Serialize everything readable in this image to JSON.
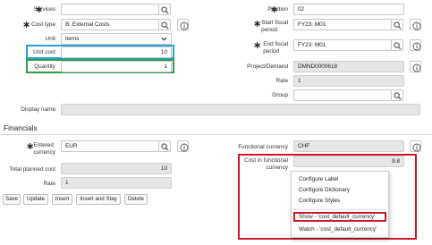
{
  "left": {
    "services": {
      "label": "Services",
      "value": ""
    },
    "cost_type": {
      "label": "Cost type",
      "value": "B: External Costs"
    },
    "unit": {
      "label": "Unit",
      "value": "items"
    },
    "unit_cost": {
      "label": "Unit cost",
      "value": "10"
    },
    "quantity": {
      "label": "Quantity",
      "value": "1"
    },
    "display_name": {
      "label": "Display name",
      "value": ""
    }
  },
  "right": {
    "position": {
      "label": "Position",
      "value": "02"
    },
    "start_fiscal_period": {
      "label_line1": "Start fiscal",
      "label_line2": "period",
      "value": "FY23: M01"
    },
    "end_fiscal_period": {
      "label_line1": "End fiscal",
      "label_line2": "period",
      "value": "FY23: M01"
    },
    "project_demand": {
      "label": "Project/Demand",
      "value": "DMND0000618"
    },
    "rate": {
      "label": "Rate",
      "value": "1"
    },
    "group": {
      "label": "Group",
      "value": ""
    }
  },
  "financials": {
    "title": "Financials",
    "entered_currency": {
      "label_line1": "Entered",
      "label_line2": "currency",
      "value": "EUR"
    },
    "total_planned_cost": {
      "label": "Total planned cost",
      "value": "10"
    },
    "rate": {
      "label": "Rate",
      "value": "1"
    },
    "functional_currency": {
      "label": "Functional currency",
      "value": "CHF"
    },
    "cost_in_functional_currency": {
      "label_line1": "Cost in functional",
      "label_line2": "currency",
      "value": "9.8"
    }
  },
  "buttons": {
    "save": "Save",
    "update": "Update",
    "insert": "Insert",
    "insert_and_stay": "Insert and Stay",
    "delete": "Delete"
  },
  "context_menu": {
    "items": [
      "Configure Label",
      "Configure Dictionary",
      "Configure Styles",
      "Show - 'cost_default_currency'",
      "Watch - 'cost_default_currency'"
    ]
  },
  "colors": {
    "highlight_blue": "#2aa0d8",
    "highlight_green": "#2e9e4a",
    "highlight_red": "#d0182a",
    "readonly_bg": "#e6e6e6"
  }
}
